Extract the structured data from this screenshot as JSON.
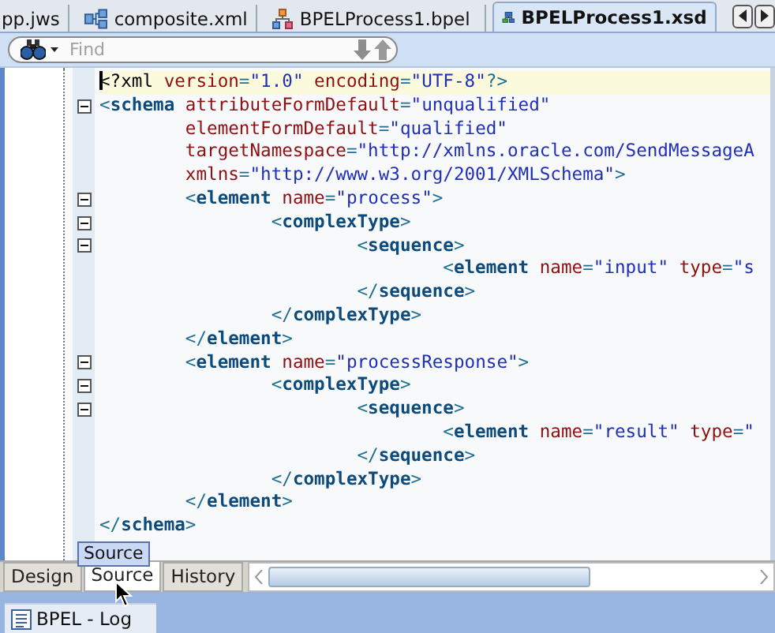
{
  "editor_tabs": [
    {
      "label": "pp.jws",
      "kind": "workspace",
      "selected": false
    },
    {
      "label": "composite.xml",
      "kind": "composite",
      "selected": false
    },
    {
      "label": "BPELProcess1.bpel",
      "kind": "bpel",
      "selected": false
    },
    {
      "label": "BPELProcess1.xsd",
      "kind": "xsd",
      "selected": true
    }
  ],
  "find": {
    "placeholder": "Find"
  },
  "code_lines": [
    {
      "fold_marker": false,
      "current": true,
      "tokens": [
        {
          "kind": "plain",
          "text": "<?xml "
        },
        {
          "kind": "attr",
          "text": "version"
        },
        {
          "kind": "punct",
          "text": "="
        },
        {
          "kind": "value",
          "text": "\"1.0\" "
        },
        {
          "kind": "attr",
          "text": "encoding"
        },
        {
          "kind": "punct",
          "text": "="
        },
        {
          "kind": "value",
          "text": "\"UTF-8\""
        },
        {
          "kind": "punct",
          "text": "?>"
        }
      ]
    },
    {
      "fold_marker": true,
      "current": false,
      "tokens": [
        {
          "kind": "punct",
          "text": "<"
        },
        {
          "kind": "tag",
          "text": "schema "
        },
        {
          "kind": "attr",
          "text": "attributeFormDefault"
        },
        {
          "kind": "punct",
          "text": "="
        },
        {
          "kind": "value",
          "text": "\"unqualified\""
        }
      ]
    },
    {
      "fold_marker": false,
      "current": false,
      "tokens": [
        {
          "kind": "attr",
          "text": "        elementFormDefault"
        },
        {
          "kind": "punct",
          "text": "="
        },
        {
          "kind": "value",
          "text": "\"qualified\""
        }
      ]
    },
    {
      "fold_marker": false,
      "current": false,
      "tokens": [
        {
          "kind": "attr",
          "text": "        targetNamespace"
        },
        {
          "kind": "punct",
          "text": "="
        },
        {
          "kind": "value",
          "text": "\"http://xmlns.oracle.com/SendMessageA"
        }
      ]
    },
    {
      "fold_marker": false,
      "current": false,
      "tokens": [
        {
          "kind": "attr",
          "text": "        xmlns"
        },
        {
          "kind": "punct",
          "text": "="
        },
        {
          "kind": "value",
          "text": "\"http://www.w3.org/2001/XMLSchema\""
        },
        {
          "kind": "punct",
          "text": ">"
        }
      ]
    },
    {
      "fold_marker": true,
      "current": false,
      "tokens": [
        {
          "kind": "punct",
          "text": "        <"
        },
        {
          "kind": "tag",
          "text": "element "
        },
        {
          "kind": "attr",
          "text": "name"
        },
        {
          "kind": "punct",
          "text": "="
        },
        {
          "kind": "value",
          "text": "\"process\""
        },
        {
          "kind": "punct",
          "text": ">"
        }
      ]
    },
    {
      "fold_marker": true,
      "current": false,
      "tokens": [
        {
          "kind": "punct",
          "text": "                <"
        },
        {
          "kind": "tag",
          "text": "complexType"
        },
        {
          "kind": "punct",
          "text": ">"
        }
      ]
    },
    {
      "fold_marker": true,
      "current": false,
      "tokens": [
        {
          "kind": "punct",
          "text": "                        <"
        },
        {
          "kind": "tag",
          "text": "sequence"
        },
        {
          "kind": "punct",
          "text": ">"
        }
      ]
    },
    {
      "fold_marker": false,
      "current": false,
      "tokens": [
        {
          "kind": "punct",
          "text": "                                <"
        },
        {
          "kind": "tag",
          "text": "element "
        },
        {
          "kind": "attr",
          "text": "name"
        },
        {
          "kind": "punct",
          "text": "="
        },
        {
          "kind": "value",
          "text": "\"input\" "
        },
        {
          "kind": "attr",
          "text": "type"
        },
        {
          "kind": "punct",
          "text": "="
        },
        {
          "kind": "value",
          "text": "\"s"
        }
      ]
    },
    {
      "fold_marker": false,
      "current": false,
      "tokens": [
        {
          "kind": "punct",
          "text": "                        </"
        },
        {
          "kind": "tag",
          "text": "sequence"
        },
        {
          "kind": "punct",
          "text": ">"
        }
      ]
    },
    {
      "fold_marker": false,
      "current": false,
      "tokens": [
        {
          "kind": "punct",
          "text": "                </"
        },
        {
          "kind": "tag",
          "text": "complexType"
        },
        {
          "kind": "punct",
          "text": ">"
        }
      ]
    },
    {
      "fold_marker": false,
      "current": false,
      "tokens": [
        {
          "kind": "punct",
          "text": "        </"
        },
        {
          "kind": "tag",
          "text": "element"
        },
        {
          "kind": "punct",
          "text": ">"
        }
      ]
    },
    {
      "fold_marker": true,
      "current": false,
      "tokens": [
        {
          "kind": "punct",
          "text": "        <"
        },
        {
          "kind": "tag",
          "text": "element "
        },
        {
          "kind": "attr",
          "text": "name"
        },
        {
          "kind": "punct",
          "text": "="
        },
        {
          "kind": "value",
          "text": "\"processResponse\""
        },
        {
          "kind": "punct",
          "text": ">"
        }
      ]
    },
    {
      "fold_marker": true,
      "current": false,
      "tokens": [
        {
          "kind": "punct",
          "text": "                <"
        },
        {
          "kind": "tag",
          "text": "complexType"
        },
        {
          "kind": "punct",
          "text": ">"
        }
      ]
    },
    {
      "fold_marker": true,
      "current": false,
      "tokens": [
        {
          "kind": "punct",
          "text": "                        <"
        },
        {
          "kind": "tag",
          "text": "sequence"
        },
        {
          "kind": "punct",
          "text": ">"
        }
      ]
    },
    {
      "fold_marker": false,
      "current": false,
      "tokens": [
        {
          "kind": "punct",
          "text": "                                <"
        },
        {
          "kind": "tag",
          "text": "element "
        },
        {
          "kind": "attr",
          "text": "name"
        },
        {
          "kind": "punct",
          "text": "="
        },
        {
          "kind": "value",
          "text": "\"result\" "
        },
        {
          "kind": "attr",
          "text": "type"
        },
        {
          "kind": "punct",
          "text": "="
        },
        {
          "kind": "value",
          "text": "\""
        }
      ]
    },
    {
      "fold_marker": false,
      "current": false,
      "tokens": [
        {
          "kind": "punct",
          "text": "                        </"
        },
        {
          "kind": "tag",
          "text": "sequence"
        },
        {
          "kind": "punct",
          "text": ">"
        }
      ]
    },
    {
      "fold_marker": false,
      "current": false,
      "tokens": [
        {
          "kind": "punct",
          "text": "                </"
        },
        {
          "kind": "tag",
          "text": "complexType"
        },
        {
          "kind": "punct",
          "text": ">"
        }
      ]
    },
    {
      "fold_marker": false,
      "current": false,
      "tokens": [
        {
          "kind": "punct",
          "text": "        </"
        },
        {
          "kind": "tag",
          "text": "element"
        },
        {
          "kind": "punct",
          "text": ">"
        }
      ]
    },
    {
      "fold_marker": false,
      "current": false,
      "tokens": [
        {
          "kind": "punct",
          "text": "</"
        },
        {
          "kind": "tag",
          "text": "schema"
        },
        {
          "kind": "punct",
          "text": ">"
        }
      ]
    }
  ],
  "view_tabs": [
    {
      "label": "Design",
      "selected": false
    },
    {
      "label": "Source",
      "selected": true
    },
    {
      "label": "History",
      "selected": false
    }
  ],
  "tooltip": "Source",
  "log_tab": {
    "label": "BPEL - Log"
  }
}
